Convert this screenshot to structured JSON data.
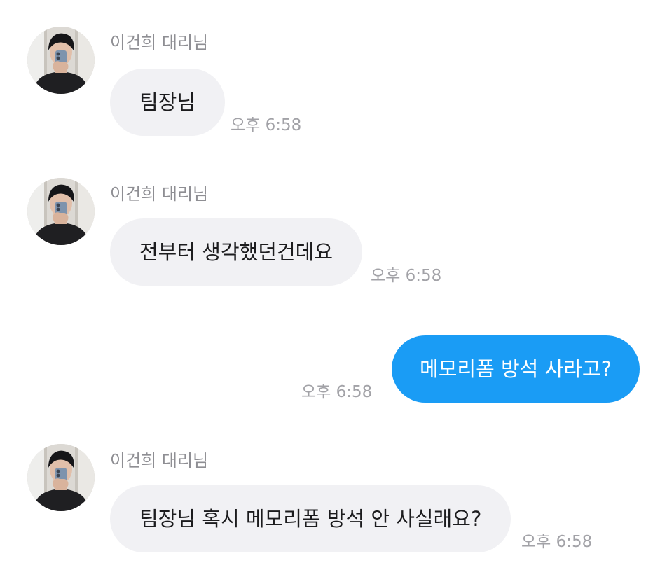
{
  "messages": [
    {
      "direction": "incoming",
      "sender": "이건희 대리님",
      "text": "팀장님",
      "time": "오후 6:58"
    },
    {
      "direction": "incoming",
      "sender": "이건희 대리님",
      "text": "전부터 생각했던건데요",
      "time": "오후 6:58"
    },
    {
      "direction": "outgoing",
      "text": "메모리폼 방석 사라고?",
      "time": "오후 6:58"
    },
    {
      "direction": "incoming",
      "sender": "이건희 대리님",
      "text": "팀장님 혹시 메모리폼 방석 안 사실래요?",
      "time": "오후 6:58"
    }
  ],
  "colors": {
    "incoming_bubble": "#f1f1f4",
    "outgoing_bubble": "#1a9cf5",
    "sender_name": "#8e8e93",
    "timestamp": "#a2a2a7"
  }
}
